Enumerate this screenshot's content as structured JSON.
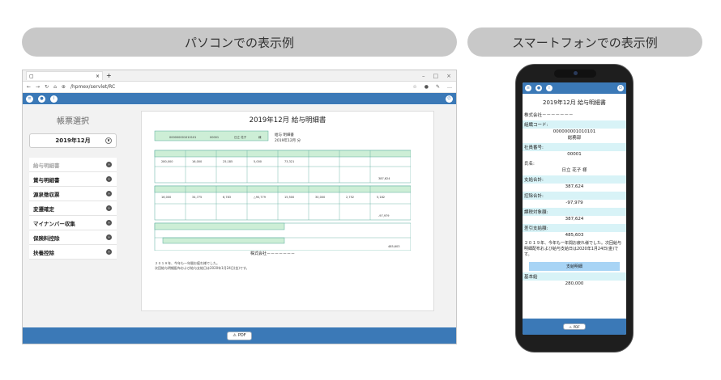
{
  "headings": {
    "pc": "パソコンでの表示例",
    "sp": "スマートフォンでの表示例"
  },
  "browser": {
    "tab_close": "×",
    "tab_new": "+",
    "url": "/hpmex/servlet/RC",
    "controls": {
      "min": "–",
      "max": "□",
      "close": "×"
    }
  },
  "sidebar": {
    "title": "帳票選択",
    "month": "2019年12月",
    "items": [
      {
        "label": "給与明細書"
      },
      {
        "label": "賞与明細書"
      },
      {
        "label": "源泉徴収票"
      },
      {
        "label": "変遷確定"
      },
      {
        "label": "マイナンバー収集"
      },
      {
        "label": "保険料控除"
      },
      {
        "label": "扶養控除"
      }
    ]
  },
  "document": {
    "title": "2019年12月 給与明細書",
    "company": "株式会社－－－－－－－",
    "notes": [
      "２０１９年、今年も一年間お疲れ様でした。",
      "次回給与明細配布および給与支給日は2020年1月24日(金)です。"
    ],
    "header_cells": {
      "code": "000000001010101",
      "staff": "00001",
      "name": "日立 花子",
      "suffix": "様",
      "kind": "給与 明細書",
      "period": "2019年12月 分"
    },
    "earn_values": [
      "280,000",
      "16,000",
      "25,185",
      "5,000",
      "73,321"
    ],
    "deduct_values": [
      "16,000",
      "34,775",
      "6,783",
      "△90,779",
      "15,500",
      "30,000",
      "2,752",
      "5,182"
    ],
    "totals": {
      "pay": "387,624",
      "deduct": "-97,979",
      "net": "485,603"
    }
  },
  "pdf_label": "PDF",
  "phone": {
    "title": "2019年12月 給与明細書",
    "company": "株式会社－－－－－－－",
    "fields": [
      {
        "label": "組織コード:",
        "value": "000000001010101\n総務部"
      },
      {
        "label": "社員番号:",
        "value": "00001"
      },
      {
        "label": "氏名:",
        "value": "日立 花子 様"
      },
      {
        "label": "支給合計:",
        "value": "387,624"
      },
      {
        "label": "控除合計:",
        "value": "-97,979"
      },
      {
        "label": "課税対象額:",
        "value": "387,624"
      },
      {
        "label": "差引支給額:",
        "value": "485,603"
      }
    ],
    "message": "２０１９年、今年も一年間お疲れ様でした。次回給与明細配布および給与支給日は2020年1月24日(金)です。",
    "button": "支給明細",
    "item_label": "基本給",
    "item_value": "280,000"
  },
  "colors": {
    "accent": "#3b79b7",
    "pill": "#c8c8c8",
    "green": "#cdeed6",
    "cyan": "#d8f3f7"
  }
}
